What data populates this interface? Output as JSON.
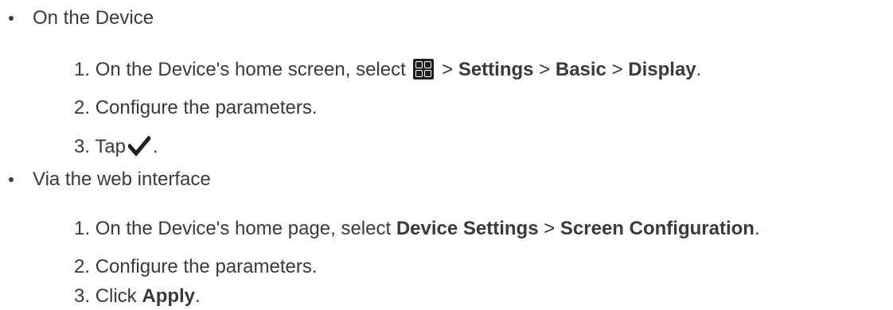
{
  "sections": [
    {
      "bullet": "On the Device",
      "steps": [
        {
          "number": "1.",
          "prefix": "On the Device's home screen, select",
          "icon": "apps-grid-icon",
          "path": [
            {
              "sep": ">",
              "label": "Settings"
            },
            {
              "sep": ">",
              "label": "Basic"
            },
            {
              "sep": ">",
              "label": "Display"
            }
          ],
          "end": "."
        },
        {
          "number": "2.",
          "text": "Configure the parameters."
        },
        {
          "number": "3.",
          "prefix": "Tap",
          "icon": "checkmark-icon",
          "end": "."
        }
      ]
    },
    {
      "bullet": "Via the web interface",
      "steps": [
        {
          "number": "1.",
          "prefix": "On the Device's home page, select",
          "path": [
            {
              "sep": "",
              "label": "Device Settings"
            },
            {
              "sep": ">",
              "label": "Screen Configuration"
            }
          ],
          "end": "."
        },
        {
          "number": "2.",
          "text": "Configure the parameters."
        },
        {
          "number": "3.",
          "prefix": "Click",
          "bold": "Apply",
          "end": "."
        }
      ]
    }
  ]
}
